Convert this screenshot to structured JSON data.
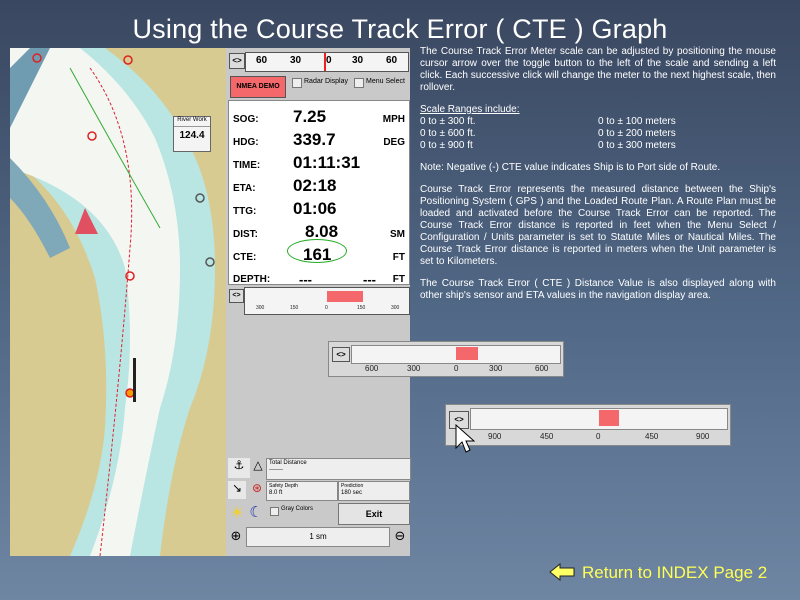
{
  "title": "Using the Course Track Error ( CTE ) Graph",
  "map": {
    "river_work_label": "River Work",
    "river_work_value": "124.4"
  },
  "panel": {
    "top_toggle": "<>",
    "top_scale_ticks": [
      "60",
      "30",
      "0",
      "30",
      "60"
    ],
    "nmea_demo": "NMEA DEMO",
    "radar_display": "Radar Display",
    "menu_select": "Menu Select",
    "rows": [
      {
        "label": "SOG:",
        "value": "7.25",
        "unit": "MPH"
      },
      {
        "label": "HDG:",
        "value": "339.7",
        "unit": "DEG"
      },
      {
        "label": "TIME:",
        "value": "01:11:31",
        "unit": ""
      },
      {
        "label": "ETA:",
        "value": "02:18",
        "unit": ""
      },
      {
        "label": "TTG:",
        "value": "01:06",
        "unit": ""
      },
      {
        "label": "DIST:",
        "value": "8.08",
        "unit": "SM"
      },
      {
        "label": "CTE:",
        "value": "161",
        "unit": "FT"
      },
      {
        "label": "DEPTH:",
        "value": "---",
        "value2": "---",
        "unit": "FT"
      }
    ],
    "cte_toggle": "<>",
    "cte_ticks": [
      "300",
      "150",
      "0",
      "150",
      "300"
    ],
    "total_distance": "Total Distance",
    "total_distance_value": "-------",
    "safety_depth": "Safety Depth",
    "safety_depth_value": "8.0 ft",
    "prediction": "Prediction",
    "prediction_value": "180 sec",
    "gray_colors": "Gray Colors",
    "exit": "Exit",
    "zoom_value": "1 sm"
  },
  "description": {
    "p1": "The Course Track Error Meter scale can be adjusted by positioning the mouse cursor arrow over the toggle button to the left of the scale and sending a left click.  Each successive click will change the meter to the next highest scale, then rollover.",
    "ranges_heading": "Scale Ranges include:",
    "ranges": [
      {
        "ft": "0 to ± 300   ft.",
        "m": "0 to ± 100   meters"
      },
      {
        "ft": "0 to ± 600   ft.",
        "m": "0 to ± 200   meters"
      },
      {
        "ft": "0 to ± 900   ft",
        "m": "0 to ± 300   meters"
      }
    ],
    "p2": "Note:  Negative (-)  CTE value indicates Ship is to Port side of Route.",
    "p3": "Course Track Error represents the measured distance between the Ship's Positioning System ( GPS ) and the Loaded Route Plan.  A Route Plan must be loaded and activated before the Course Track Error can be reported.   The Course Track Error distance is reported in feet when the Menu Select / Configuration / Units parameter is set to Statute Miles or Nautical Miles.  The Course Track Error distance is reported in meters when the Unit parameter is set to Kilometers.",
    "p4": "The Course Track Error ( CTE ) Distance Value is also displayed along with other ship's sensor and ETA values in the navigation display area."
  },
  "meter600": {
    "toggle": "<>",
    "ticks": [
      "600",
      "300",
      "0",
      "300",
      "600"
    ]
  },
  "meter900": {
    "toggle": "<>",
    "ticks": [
      "900",
      "450",
      "0",
      "450",
      "900"
    ]
  },
  "index_link": "Return to INDEX Page 2",
  "colors": {
    "cte_bar": "#f4686b",
    "index_text": "#ffff55",
    "nmea_button": "#f4686b"
  }
}
